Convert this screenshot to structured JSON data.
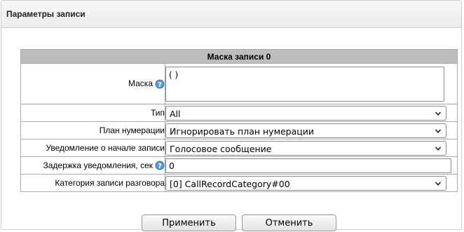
{
  "panel": {
    "title": "Параметры записи"
  },
  "mask_table": {
    "header": "Маска записи 0",
    "mask": {
      "label": "Маска",
      "value": "( )"
    },
    "type": {
      "label": "Тип",
      "value": "All"
    },
    "numbering_plan": {
      "label": "План нумерации",
      "value": "Игнорировать план нумерации"
    },
    "notification": {
      "label": "Уведомление о начале записи",
      "value": "Голосовое сообщение"
    },
    "delay": {
      "label": "Задержка уведомления, сек",
      "value": "0"
    },
    "category": {
      "label": "Категория записи разговора",
      "value": "[0] CallRecordCategory#00"
    }
  },
  "buttons": {
    "apply": "Применить",
    "cancel": "Отменить"
  },
  "icons": {
    "help": "help-icon",
    "dropdown": "chevron-down-icon"
  },
  "colors": {
    "header_bg": "#bdbdbd",
    "help_icon": "#3a78c8"
  }
}
